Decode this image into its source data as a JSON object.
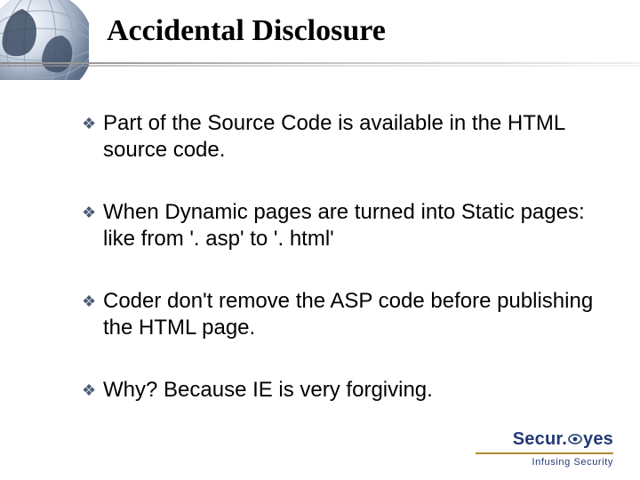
{
  "title": "Accidental Disclosure",
  "bullets": [
    "Part of the Source Code is available in the HTML source code.",
    "When Dynamic pages are turned into Static pages: like from '. asp' to '. html'",
    "Coder don't remove the ASP code before publishing the HTML page.",
    "Why? Because IE is very forgiving."
  ],
  "logo": {
    "brand": "Secur.Eyes",
    "tagline": "Infusing Security"
  },
  "colors": {
    "bullet": "#4a5a78",
    "logo_primary": "#233a74",
    "logo_rule": "#b08a2e"
  }
}
